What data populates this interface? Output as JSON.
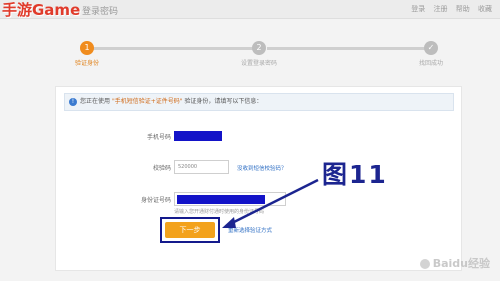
{
  "header": {
    "brand": "手游Game",
    "title": "登录密码",
    "links": [
      "登录",
      "注册",
      "帮助",
      "收藏"
    ]
  },
  "steps": [
    {
      "number": "1",
      "label": "验证身份",
      "active": true
    },
    {
      "number": "2",
      "label": "设置登录密码",
      "active": false
    },
    {
      "number": "✓",
      "label": "找回成功",
      "active": false
    }
  ],
  "notice": {
    "icon": "info-icon",
    "prefix": "您正在使用",
    "highlight": "\"手机短信验证+证件号码\"",
    "suffix": "验证身份，请填写以下信息："
  },
  "form": {
    "phone_label": "手机号码",
    "code_label": "校验码",
    "code_value": "520000",
    "code_link": "没收到短信校验码？",
    "id_label": "身份证号码",
    "id_hint": "请输入您开通财付通时使用的身份证号码",
    "next_label": "下一步",
    "alt_link": "重新选择验证方式"
  },
  "annotation": {
    "label": "图11",
    "color": "#1c2590"
  },
  "watermark": "Baidu经验",
  "colors": {
    "accent": "#f08c1e",
    "redaction": "#1313c8",
    "link": "#2f6fc4"
  }
}
